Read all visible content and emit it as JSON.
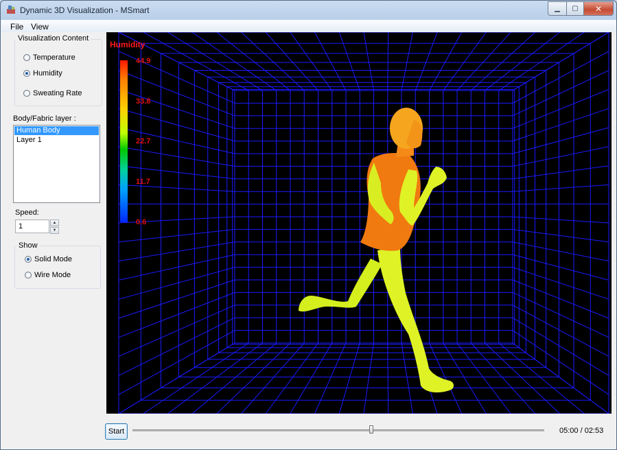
{
  "window": {
    "title": "Dynamic 3D Visualization - MSmart",
    "minimize_icon": "minimize-icon",
    "maximize_icon": "maximize-icon",
    "close_icon": "close-icon"
  },
  "menu": {
    "file": "File",
    "view": "View"
  },
  "sidebar": {
    "content_group": {
      "title": "Visualization Content",
      "options": [
        {
          "label": "Temperature",
          "selected": false
        },
        {
          "label": "Humidity",
          "selected": true
        },
        {
          "label": "Sweating Rate",
          "selected": false
        }
      ]
    },
    "layer_label": "Body/Fabric layer :",
    "layers": [
      {
        "label": "Human Body",
        "selected": true
      },
      {
        "label": "Layer 1",
        "selected": false
      }
    ],
    "speed_label": "Speed:",
    "speed_value": "1",
    "show_group": {
      "title": "Show",
      "options": [
        {
          "label": "Solid Mode",
          "selected": true
        },
        {
          "label": "Wire Mode",
          "selected": false
        }
      ]
    }
  },
  "viewport": {
    "legend_title": "Humidity",
    "legend_ticks": [
      "44.9",
      "33.8",
      "22.7",
      "11.7",
      "0.6"
    ],
    "grid_color": "#1a1aff",
    "body_colors": {
      "torso": "#f07a10",
      "head": "#f5a020",
      "limbs": "#d8f020"
    }
  },
  "playback": {
    "start_label": "Start",
    "position": 0.58,
    "time": "05:00 / 02:53"
  }
}
